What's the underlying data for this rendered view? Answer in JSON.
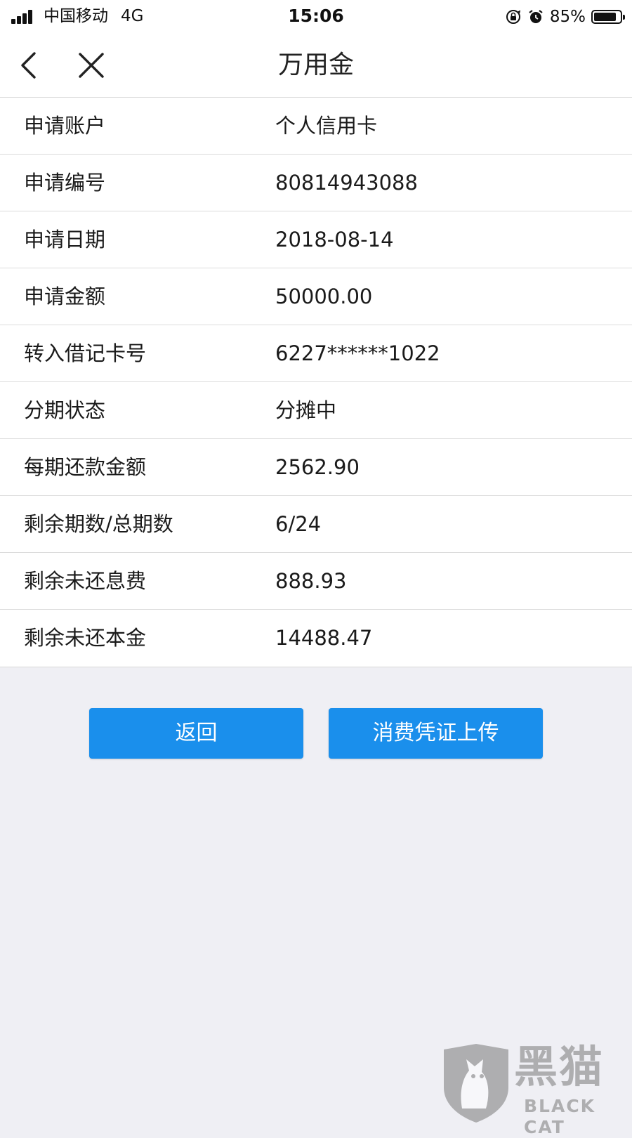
{
  "status_bar": {
    "carrier": "中国移动",
    "network": "4G",
    "time": "15:06",
    "battery_percent": "85%",
    "battery_level": 0.85
  },
  "nav": {
    "title": "万用金",
    "back_icon": "chevron-left-icon",
    "close_icon": "close-icon"
  },
  "details": [
    {
      "label": "申请账户",
      "value": "个人信用卡"
    },
    {
      "label": "申请编号",
      "value": "80814943088"
    },
    {
      "label": "申请日期",
      "value": "2018-08-14"
    },
    {
      "label": "申请金额",
      "value": "50000.00"
    },
    {
      "label": "转入借记卡号",
      "value": "6227******1022"
    },
    {
      "label": "分期状态",
      "value": "分摊中"
    },
    {
      "label": "每期还款金额",
      "value": "2562.90"
    },
    {
      "label": "剩余期数/总期数",
      "value": "6/24"
    },
    {
      "label": "剩余未还息费",
      "value": "888.93"
    },
    {
      "label": "剩余未还本金",
      "value": "14488.47"
    }
  ],
  "actions": {
    "back_label": "返回",
    "upload_label": "消费凭证上传"
  },
  "watermark": {
    "cn": "黑猫",
    "en": "BLACK CAT"
  },
  "colors": {
    "primary_button": "#1a8fec",
    "page_background": "#efeff4",
    "card_background": "#ffffff"
  }
}
